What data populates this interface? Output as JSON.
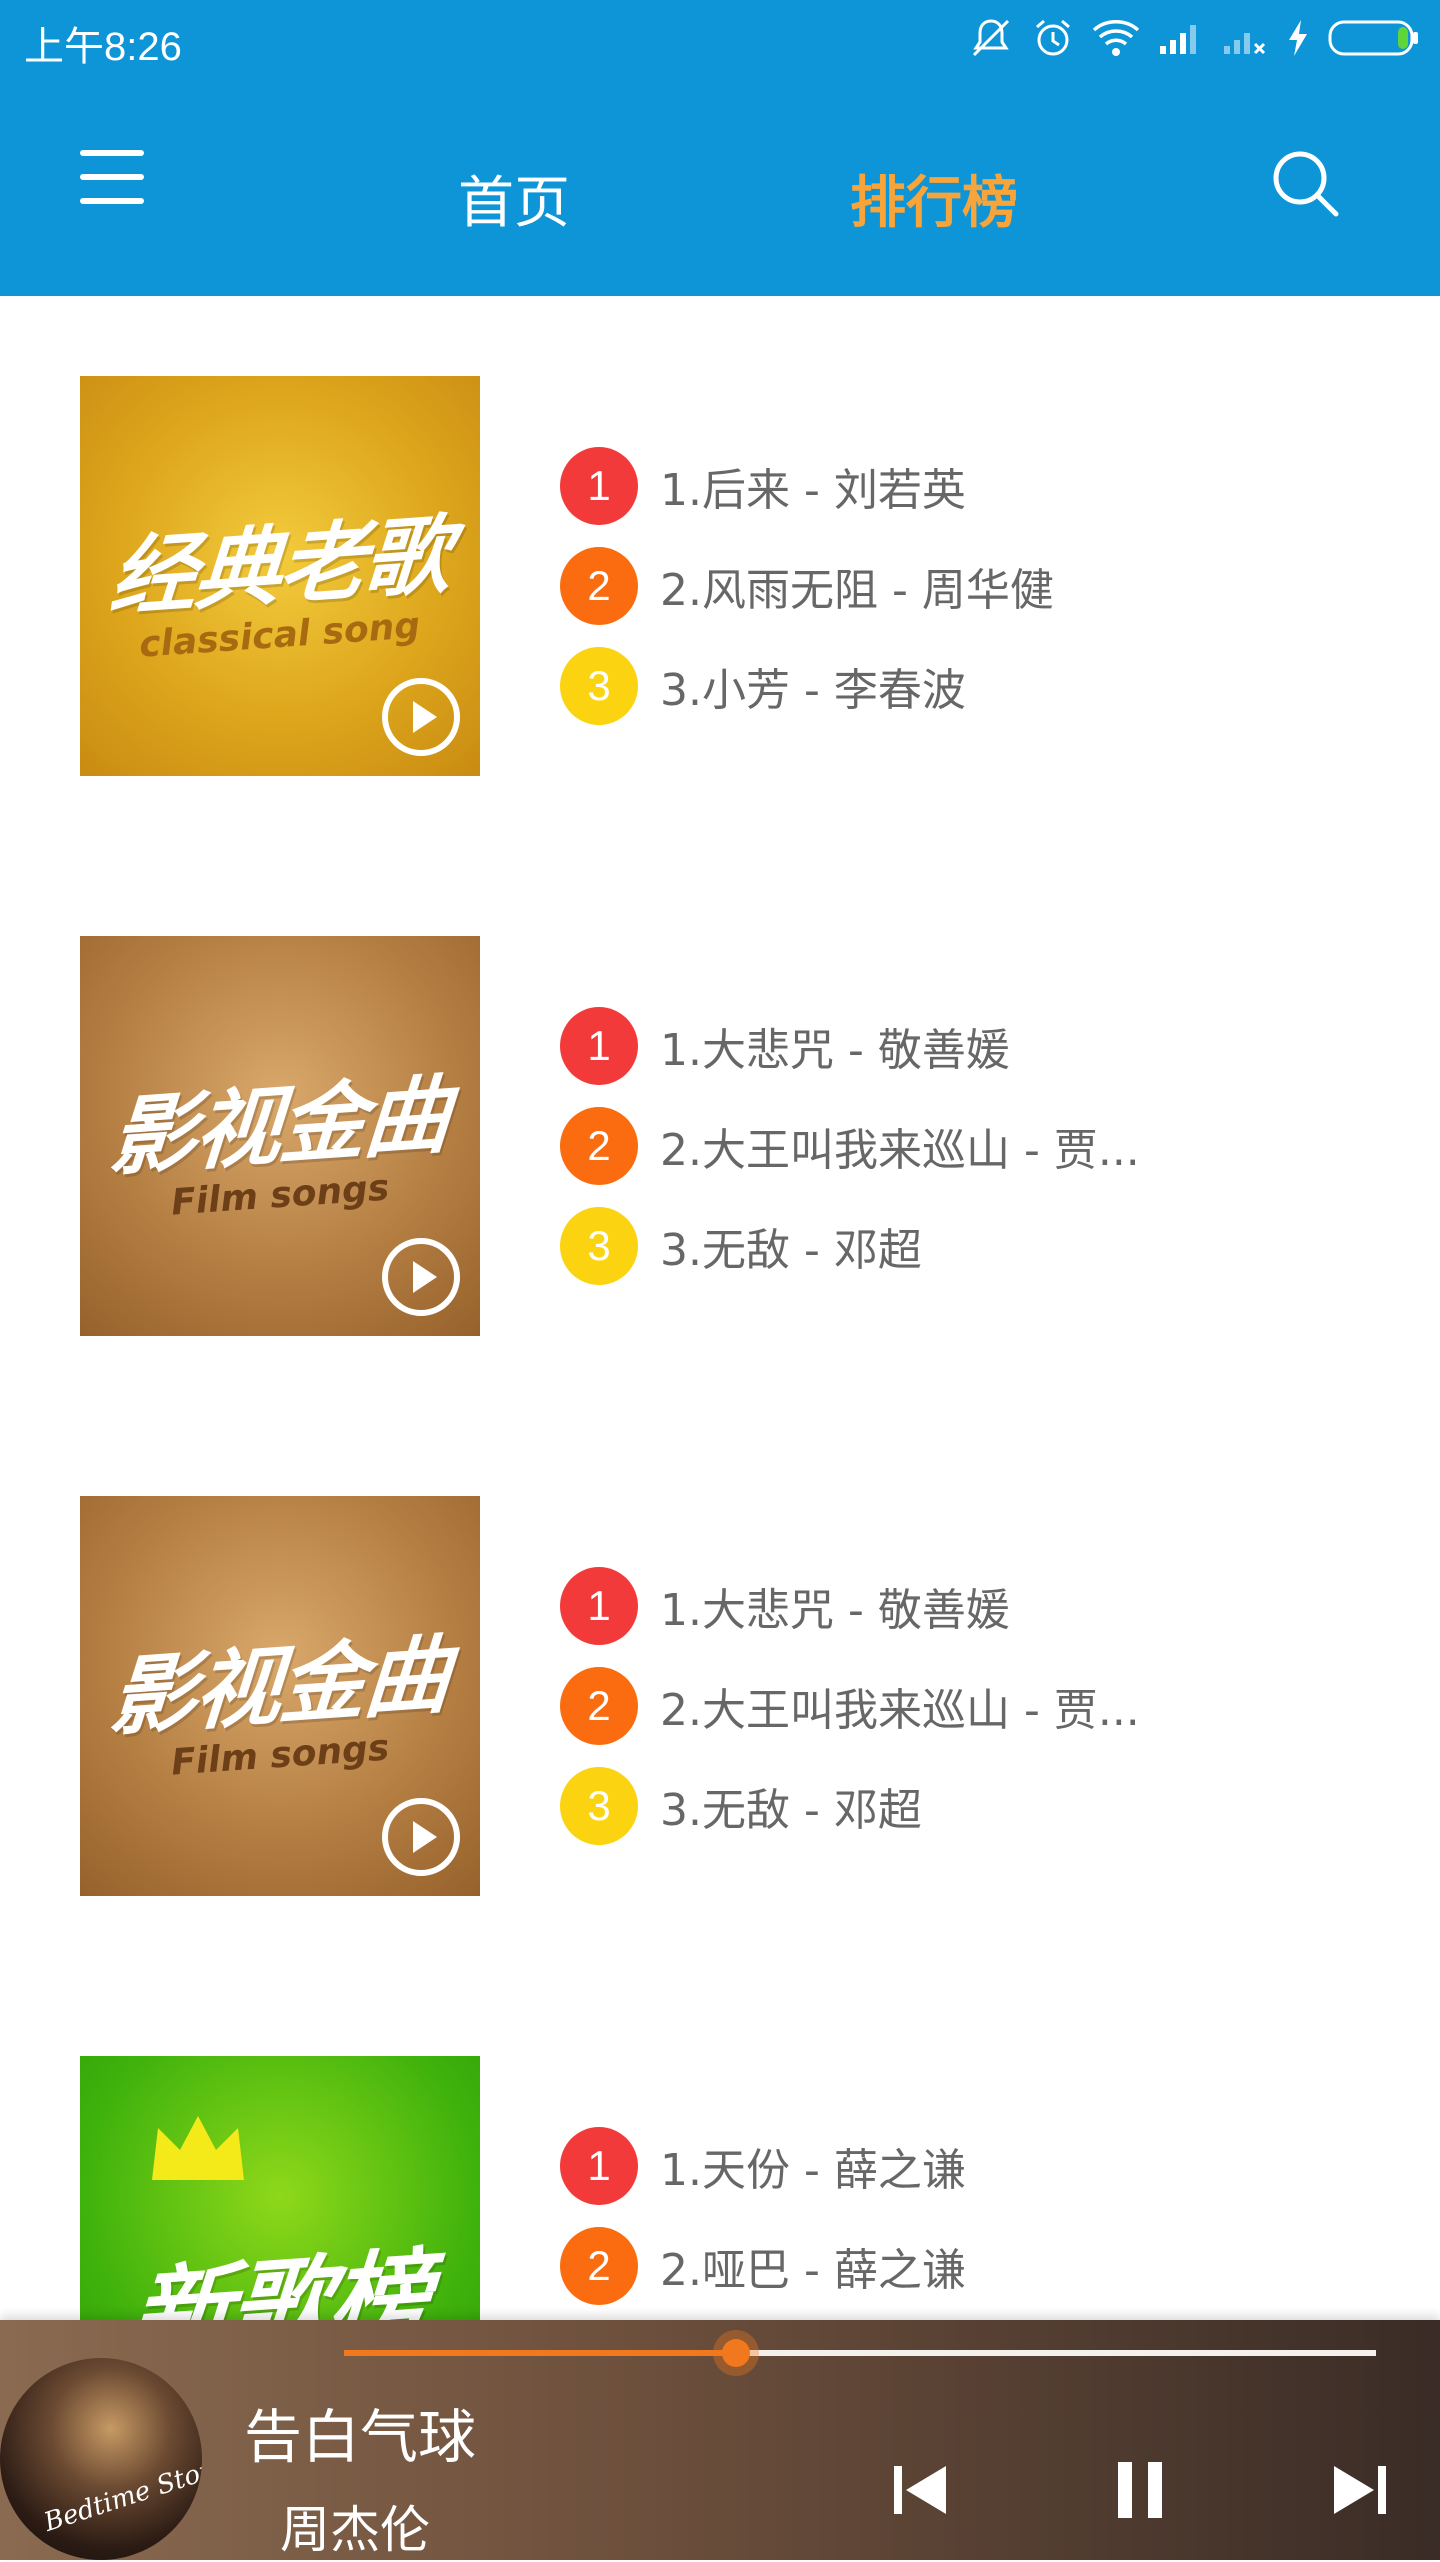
{
  "status_bar": {
    "time": "上午8:26",
    "icons": [
      "mute-icon",
      "alarm-icon",
      "wifi-icon",
      "signal-icon",
      "signal-no-sim-icon",
      "charging-icon",
      "battery-icon"
    ]
  },
  "header": {
    "tabs": [
      {
        "label": "首页",
        "active": false
      },
      {
        "label": "排行榜",
        "active": true
      }
    ],
    "accent_color": "#f7a43a",
    "bar_color": "#0d95d8"
  },
  "charts": [
    {
      "cover_title": "经典老歌",
      "cover_subtitle": "classical song",
      "songs": [
        "1.后来 - 刘若英",
        "2.风雨无阻 - 周华健",
        "3.小芳 - 李春波"
      ]
    },
    {
      "cover_title": "影视金曲",
      "cover_subtitle": "Film songs",
      "songs": [
        "1.大悲咒 - 敬善媛",
        "2.大王叫我来巡山 - 贾...",
        "3.无敌 - 邓超"
      ]
    },
    {
      "cover_title": "影视金曲",
      "cover_subtitle": "Film songs",
      "songs": [
        "1.大悲咒 - 敬善媛",
        "2.大王叫我来巡山 - 贾...",
        "3.无敌 - 邓超"
      ]
    },
    {
      "cover_title": "新歌榜",
      "songs": [
        "1.天份 - 薛之谦",
        "2.哑巴 - 薛之谦"
      ]
    }
  ],
  "rank_numbers": [
    "1",
    "2",
    "3"
  ],
  "player": {
    "title": "告白气球",
    "artist": "周杰伦",
    "progress": 0.38,
    "album_text": "Bedtime Stories",
    "progress_color": "#f2781e"
  }
}
